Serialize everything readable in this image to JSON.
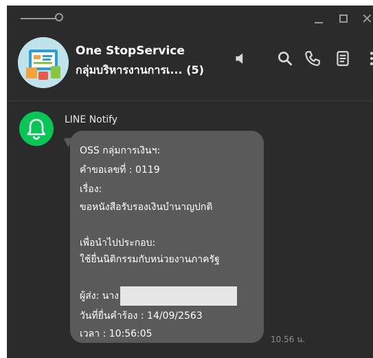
{
  "window": {
    "controls": {
      "close_glyph": "✕"
    }
  },
  "chat": {
    "title": "One StopService",
    "subtitle": "กลุ่มบริหารงานการเ... (5)",
    "avatar_icon": "infographic-avatar",
    "header_icons": [
      "speaker-icon",
      "search-icon",
      "phone-icon",
      "notes-icon",
      "more-icon"
    ]
  },
  "message": {
    "sender": "LINE Notify",
    "lines": [
      "OSS กลุ่มการเงินฯ:",
      "คำขอเลขที่ : 0119",
      "เรื่อง:",
      "ขอหนังสือรับรองเงินบำนาญปกติ",
      "",
      "เพื่อนำไปประกอบ:",
      "ใช้ยื่นนิติกรรมกับหน่วยงานภาครัฐ",
      "",
      "ผู้ส่ง: นาง",
      "วันที่ยื่นคำร้อง : 14/09/2563",
      "เวลา : 10:56:05"
    ],
    "time": "10.56 น."
  },
  "colors": {
    "background": "#2b2b2b",
    "bubble": "#5a5a5a",
    "line_green": "#06c755"
  }
}
